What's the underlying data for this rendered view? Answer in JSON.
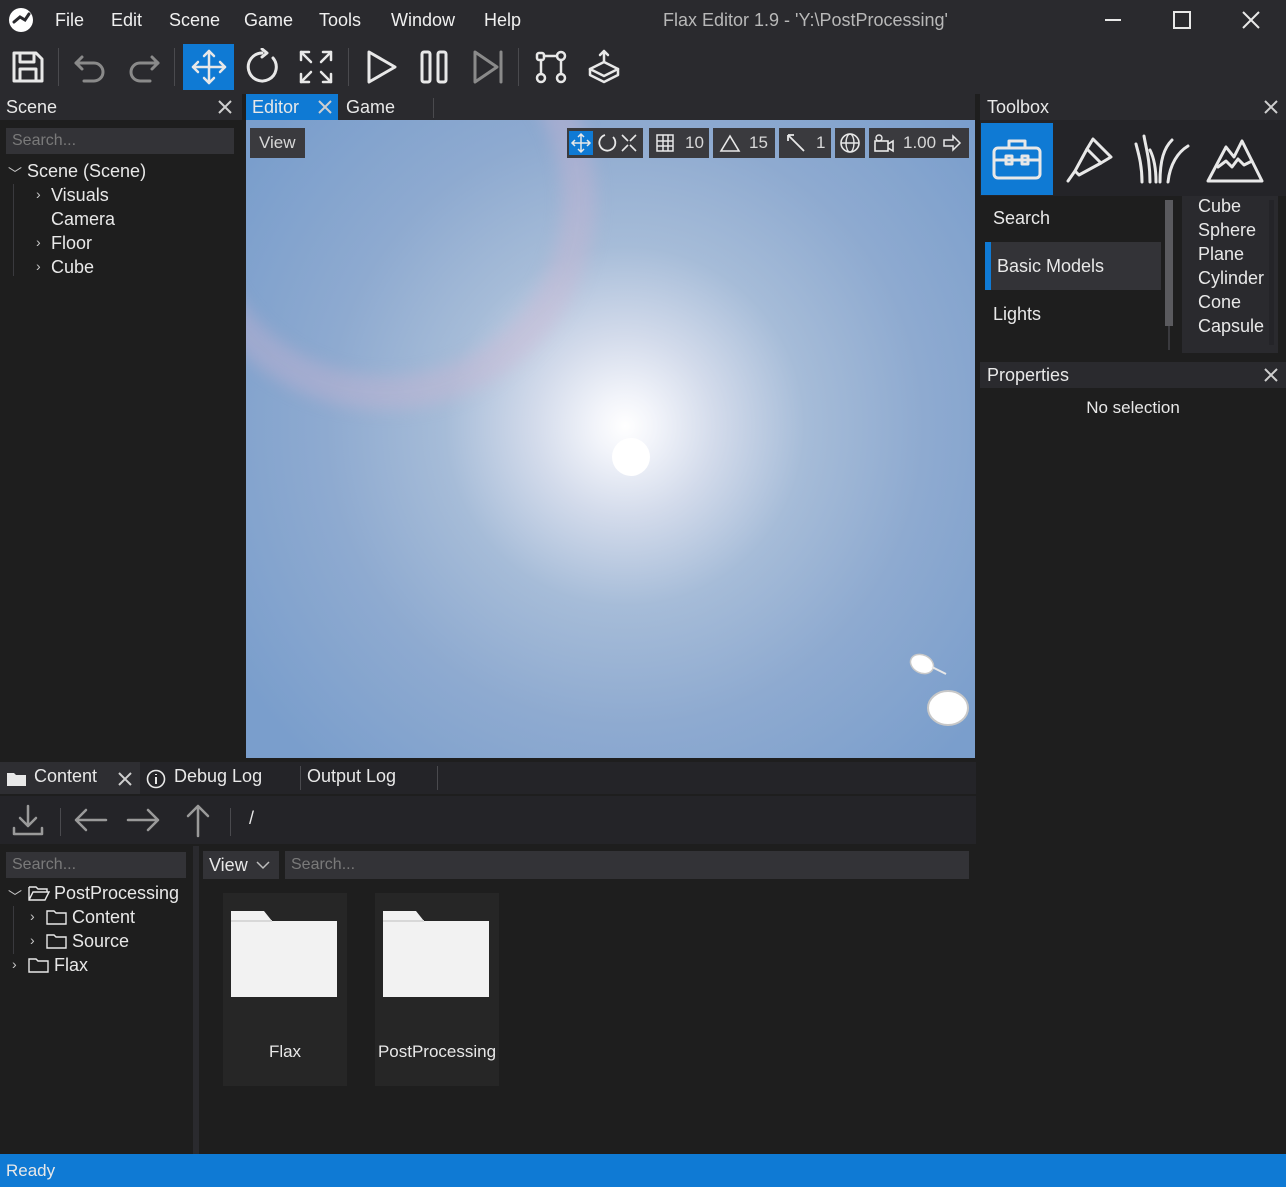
{
  "app": {
    "title": "Flax Editor 1.9 - 'Y:\\PostProcessing'",
    "menu": [
      "File",
      "Edit",
      "Scene",
      "Game",
      "Tools",
      "Window",
      "Help"
    ],
    "accent_color": "#0f7ad4"
  },
  "toolbar": {
    "icons": [
      "save-icon",
      "undo-icon",
      "redo-icon",
      "translate-gizmo-icon",
      "rotate-gizmo-icon",
      "scale-gizmo-icon",
      "play-icon",
      "pause-icon",
      "step-icon",
      "navmesh-icon",
      "build-icon"
    ],
    "active": "translate-gizmo-icon"
  },
  "scene_panel": {
    "title": "Scene",
    "search_placeholder": "Search...",
    "root": "Scene (Scene)",
    "items": [
      "Visuals",
      "Camera",
      "Floor",
      "Cube"
    ]
  },
  "viewport": {
    "tabs": [
      "Editor",
      "Game"
    ],
    "view_label": "View",
    "grid_snap": "10",
    "rotate_snap": "15",
    "scale_snap": "1",
    "camera_speed": "1.00"
  },
  "toolbox": {
    "title": "Toolbox",
    "categories": [
      "Search",
      "Basic Models",
      "Lights"
    ],
    "selected_category": "Basic Models",
    "items": [
      "Cube",
      "Sphere",
      "Plane",
      "Cylinder",
      "Cone",
      "Capsule"
    ]
  },
  "properties": {
    "title": "Properties",
    "empty_text": "No selection"
  },
  "content": {
    "tabs": [
      "Content",
      "Debug Log",
      "Output Log"
    ],
    "path": "/",
    "search_placeholder": "Search...",
    "view_label": "View",
    "tree": {
      "root": "PostProcessing",
      "children": [
        "Content",
        "Source"
      ],
      "other": "Flax"
    },
    "folders": [
      "Flax",
      "PostProcessing"
    ]
  },
  "status": {
    "text": "Ready"
  }
}
